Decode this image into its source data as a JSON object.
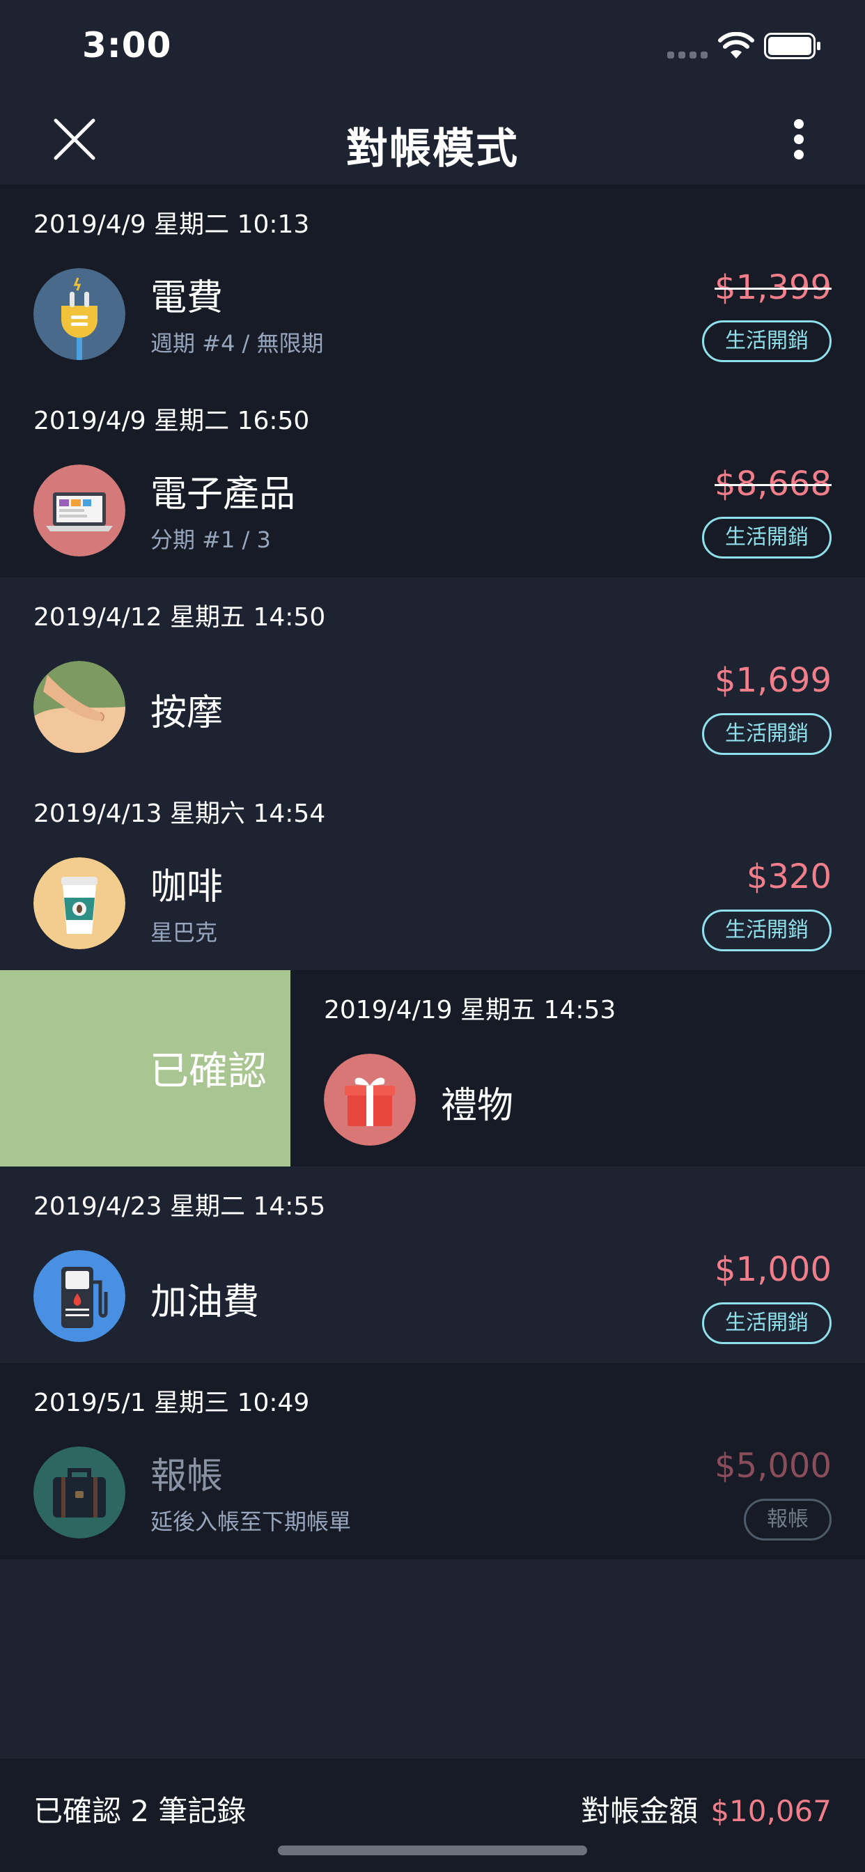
{
  "status": {
    "time": "3:00"
  },
  "header": {
    "title": "對帳模式"
  },
  "entries": [
    {
      "date": "2019/4/9 星期二 10:13",
      "name": "電費",
      "sub": "週期 #4 / 無限期",
      "amount": "$1,399",
      "tag": "生活開銷",
      "icon": "plug-icon"
    },
    {
      "date": "2019/4/9 星期二 16:50",
      "name": "電子產品",
      "sub": "分期 #1 / 3",
      "amount": "$8,668",
      "tag": "生活開銷",
      "icon": "laptop-icon"
    },
    {
      "date": "2019/4/12 星期五 14:50",
      "name": "按摩",
      "amount": "$1,699",
      "tag": "生活開銷",
      "icon": "massage-icon"
    },
    {
      "date": "2019/4/13 星期六 14:54",
      "name": "咖啡",
      "sub": "星巴克",
      "amount": "$320",
      "tag": "生活開銷",
      "icon": "coffee-cup-icon"
    },
    {
      "date": "2019/4/19 星期五 14:53",
      "name": "禮物",
      "swipe_label": "已確認",
      "icon": "gift-icon"
    },
    {
      "date": "2019/4/23 星期二 14:55",
      "name": "加油費",
      "amount": "$1,000",
      "tag": "生活開銷",
      "icon": "fuel-pump-icon"
    },
    {
      "date": "2019/5/1 星期三 10:49",
      "name": "報帳",
      "sub": "延後入帳至下期帳單",
      "amount": "$5,000",
      "tag": "報帳",
      "icon": "briefcase-icon"
    }
  ],
  "footer": {
    "confirmed_text": "已確認 2 筆記錄",
    "total_label": "對帳金額",
    "total_value": "$10,067"
  },
  "colors": {
    "background": "#1e2331",
    "row_dark": "#161b25",
    "amount": "#f07e8b",
    "tag": "#8fe0ea",
    "confirm_green": "#a9c591"
  }
}
